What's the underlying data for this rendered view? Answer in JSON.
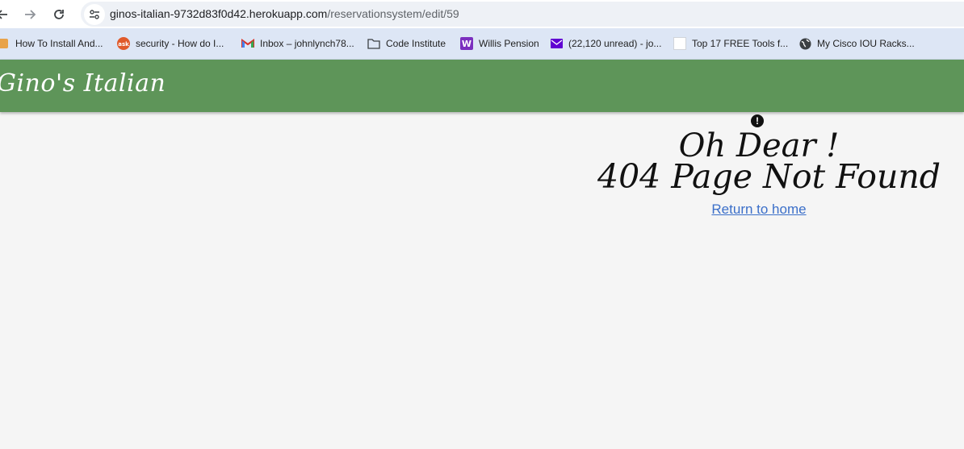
{
  "browser": {
    "url_host": "ginos-italian-9732d83f0d42.herokuapp.com",
    "url_path": "/reservationsystem/edit/59",
    "bookmarks": [
      {
        "label": "How To Install And...",
        "icon": "orange-page-icon"
      },
      {
        "label": "security - How do I...",
        "icon": "ask-icon"
      },
      {
        "label": "Inbox – johnlynch78...",
        "icon": "gmail-icon"
      },
      {
        "label": "Code Institute",
        "icon": "folder-icon"
      },
      {
        "label": "Willis Pension",
        "icon": "w-icon"
      },
      {
        "label": "(22,120 unread) - jo...",
        "icon": "mail-icon"
      },
      {
        "label": "Top 17 FREE Tools f...",
        "icon": "blank-page-icon"
      },
      {
        "label": "My Cisco IOU Racks...",
        "icon": "globe-icon"
      }
    ]
  },
  "site": {
    "brand": "Gino's Italian",
    "header_color": "#5e9559"
  },
  "error_page": {
    "heading_line1": "Oh Dear !",
    "heading_line2": "404 Page Not Found",
    "return_link": "Return to home",
    "link_color": "#3b6fc9"
  }
}
